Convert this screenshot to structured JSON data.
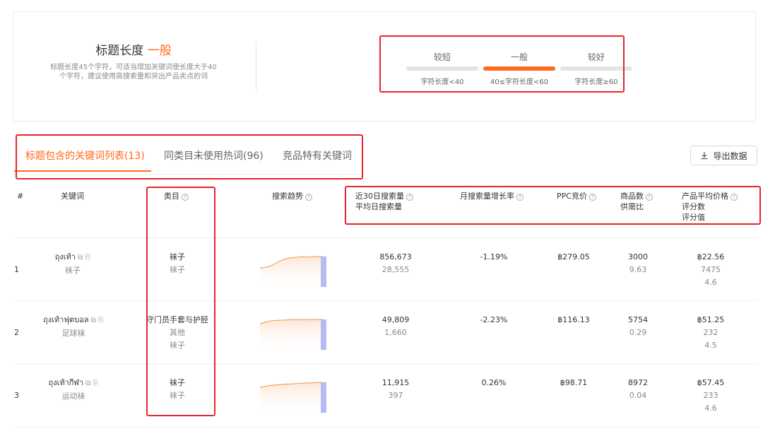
{
  "title_length": {
    "label": "标题长度",
    "level": "一般",
    "description": "标题长度45个字符，可适当增加关键词使长度大于40个字符，建议使用高搜索量和突出产品卖点的词",
    "levels": [
      {
        "name": "较短",
        "range": "字符长度<40",
        "active": false
      },
      {
        "name": "一般",
        "range": "40≤字符长度<60",
        "active": true
      },
      {
        "name": "较好",
        "range": "字符长度≥60",
        "active": false
      }
    ]
  },
  "tabs": [
    {
      "label": "标题包含的关键词列表(13)",
      "active": true
    },
    {
      "label": "同类目未使用热词(96)",
      "active": false
    },
    {
      "label": "竞品特有关键词",
      "active": false
    }
  ],
  "export_label": "导出数据",
  "table": {
    "headers": {
      "index": "#",
      "keyword": "关键词",
      "category": "类目",
      "trend": "搜索趋势",
      "search_volume": [
        "近30日搜索量",
        "平均日搜索量"
      ],
      "growth": "月搜索量增长率",
      "ppc": "PPC竞价",
      "products": [
        "商品数",
        "供需比"
      ],
      "price": [
        "产品平均价格",
        "评分数",
        "评分值"
      ]
    },
    "rows": [
      {
        "index": "1",
        "keyword": "ถุงเท้า",
        "keyword_cn": "袜子",
        "categories": [
          "袜子",
          "袜子"
        ],
        "trend": [
          0.05,
          0.1,
          0.25,
          0.55,
          0.75,
          0.85,
          0.9,
          0.92,
          0.9,
          0.95,
          0.95
        ],
        "search_volume": "856,673",
        "daily": "28,555",
        "growth": "-1.19%",
        "ppc": "฿279.05",
        "products": "3000",
        "ratio": "9.63",
        "price": "฿22.56",
        "ratings": "7475",
        "score": "4.6"
      },
      {
        "index": "2",
        "keyword": "ถุงเท้าฟุตบอล",
        "keyword_cn": "足球袜",
        "categories": [
          "守门员手套与护胫",
          "其他",
          "袜子"
        ],
        "trend": [
          0.6,
          0.75,
          0.85,
          0.88,
          0.9,
          0.92,
          0.93,
          0.92,
          0.93,
          0.94,
          0.95
        ],
        "search_volume": "49,809",
        "daily": "1,660",
        "growth": "-2.23%",
        "ppc": "฿116.13",
        "products": "5754",
        "ratio": "0.29",
        "price": "฿51.25",
        "ratings": "232",
        "score": "4.5"
      },
      {
        "index": "3",
        "keyword": "ถุงเท้ากีฬา",
        "keyword_cn": "运动袜",
        "categories": [
          "袜子",
          "袜子"
        ],
        "trend": [
          0.55,
          0.65,
          0.72,
          0.75,
          0.8,
          0.82,
          0.85,
          0.88,
          0.9,
          0.93,
          0.95
        ],
        "search_volume": "11,915",
        "daily": "397",
        "growth": "0.26%",
        "ppc": "฿98.71",
        "products": "8972",
        "ratio": "0.04",
        "price": "฿57.45",
        "ratings": "233",
        "score": "4.6"
      }
    ]
  },
  "colors": {
    "accent": "#ff6a1a",
    "annotation": "#e8242b",
    "trend_fill": "#fde6d6",
    "trend_line": "#f5a35c",
    "trend_highlight": "#b6bcf2"
  }
}
